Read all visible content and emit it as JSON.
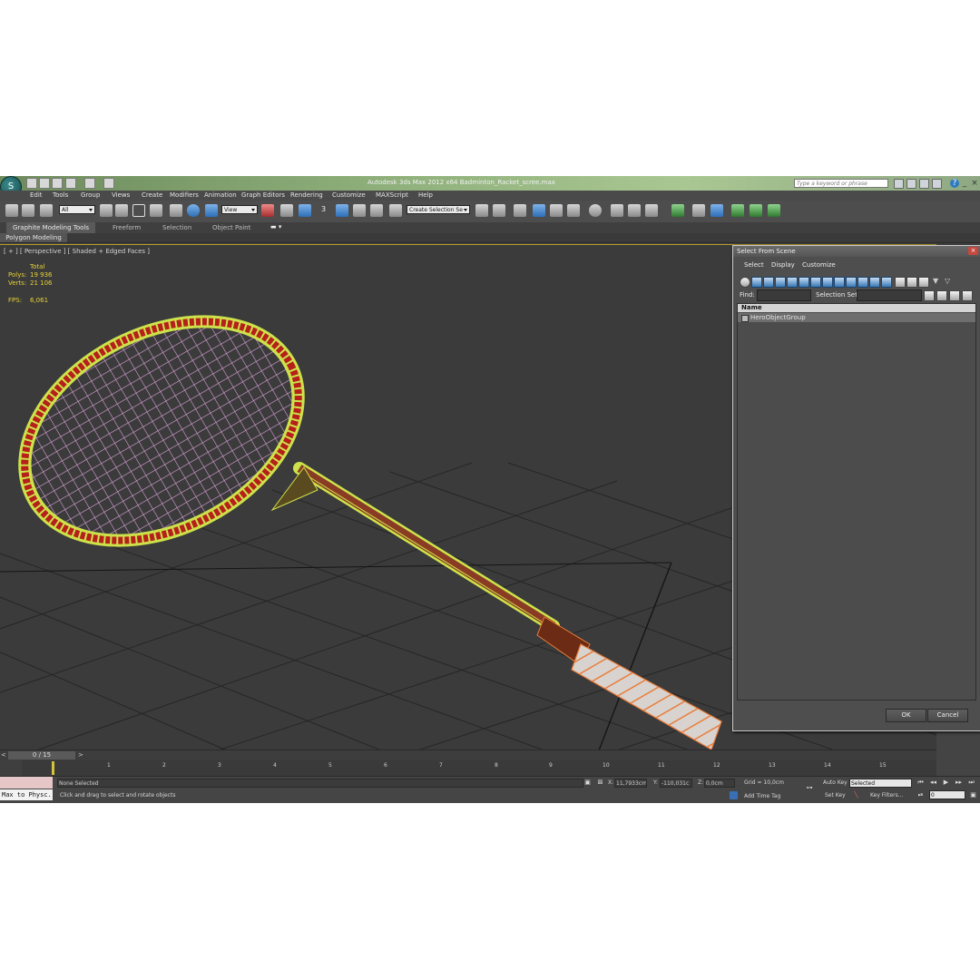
{
  "window": {
    "title": "Autodesk 3ds Max  2012 x64      Badminton_Racket_scree.max",
    "search_placeholder": "Type a keyword or phrase",
    "logo_icon": "3ds-max-logo-icon"
  },
  "menu": [
    "Edit",
    "Tools",
    "Group",
    "Views",
    "Create",
    "Modifiers",
    "Animation",
    "Graph Editors",
    "Rendering",
    "Customize",
    "MAXScript",
    "Help"
  ],
  "toolbar": {
    "selection_filter": "All",
    "reference_coord": "View",
    "snap_label": "3",
    "named_selection": "Create Selection Se"
  },
  "ribbon": {
    "tabs": [
      "Graphite Modeling Tools",
      "Freeform",
      "Selection",
      "Object Paint"
    ],
    "active_panel": "Polygon Modeling"
  },
  "viewport": {
    "label": "[ + ] [ Perspective ] [ Shaded + Edged Faces ]",
    "stats": {
      "total_label": "Total",
      "polys_label": "Polys:",
      "polys": "19 936",
      "verts_label": "Verts:",
      "verts": "21 106",
      "fps_label": "FPS:",
      "fps": "6,061"
    },
    "colors": {
      "frame": "#b5201b",
      "strings": "#d9a1d8",
      "wire": "#cde24a",
      "grip": "#e97d3b",
      "grid": "#1f1f1f"
    }
  },
  "dialog": {
    "title": "Select From Scene",
    "menu": [
      "Select",
      "Display",
      "Customize"
    ],
    "find_label": "Find:",
    "find_value": "",
    "selection_set_label": "Selection Set:",
    "selection_set_value": "",
    "column_header": "Name",
    "items": [
      "HeroObjectGroup"
    ],
    "ok": "OK",
    "cancel": "Cancel"
  },
  "timeline": {
    "frame_display": "0 / 15",
    "ticks": [
      "1",
      "2",
      "3",
      "4",
      "5",
      "6",
      "7",
      "8",
      "9",
      "10",
      "11",
      "12",
      "13",
      "14",
      "15"
    ]
  },
  "status": {
    "maxscript": "Max to Physc.",
    "selection": "None Selected",
    "prompt": "Click and drag to select and rotate objects",
    "x_label": "X:",
    "x": "11,7933cm",
    "y_label": "Y:",
    "y": "-110,031c",
    "z_label": "Z:",
    "z": "0,0cm",
    "grid": "Grid = 10,0cm",
    "add_time_tag": "Add Time Tag",
    "auto_key": "Auto Key",
    "auto_key_value": "Selected",
    "set_key": "Set Key",
    "key_filters": "Key Filters...",
    "current_frame": "0"
  }
}
